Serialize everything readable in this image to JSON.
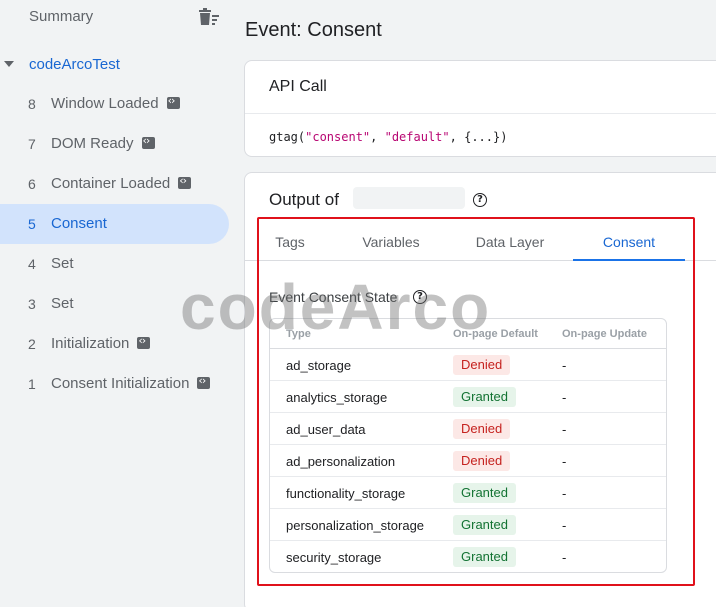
{
  "sidebar": {
    "summary_label": "Summary",
    "container_name": "codeArcoTest",
    "events": [
      {
        "num": "8",
        "label": "Window Loaded",
        "has_code": true,
        "active": false
      },
      {
        "num": "7",
        "label": "DOM Ready",
        "has_code": true,
        "active": false
      },
      {
        "num": "6",
        "label": "Container Loaded",
        "has_code": true,
        "active": false
      },
      {
        "num": "5",
        "label": "Consent",
        "has_code": false,
        "active": true
      },
      {
        "num": "4",
        "label": "Set",
        "has_code": false,
        "active": false
      },
      {
        "num": "3",
        "label": "Set",
        "has_code": false,
        "active": false
      },
      {
        "num": "2",
        "label": "Initialization",
        "has_code": true,
        "active": false
      },
      {
        "num": "1",
        "label": "Consent Initialization",
        "has_code": true,
        "active": false
      }
    ]
  },
  "main": {
    "title": "Event: Consent",
    "api_call": {
      "title": "API Call",
      "code_prefix": "gtag(",
      "arg1": "\"consent\"",
      "sep": ", ",
      "arg2": "\"default\"",
      "code_suffix": ", {...})"
    },
    "output": {
      "title": "Output of",
      "tabs": [
        "Tags",
        "Variables",
        "Data Layer",
        "Consent"
      ],
      "active_tab": "Consent",
      "section_title": "Event Consent State",
      "columns": [
        "Type",
        "On-page Default",
        "On-page Update"
      ],
      "rows": [
        {
          "type": "ad_storage",
          "default": "Denied",
          "update": "-"
        },
        {
          "type": "analytics_storage",
          "default": "Granted",
          "update": "-"
        },
        {
          "type": "ad_user_data",
          "default": "Denied",
          "update": "-"
        },
        {
          "type": "ad_personalization",
          "default": "Denied",
          "update": "-"
        },
        {
          "type": "functionality_storage",
          "default": "Granted",
          "update": "-"
        },
        {
          "type": "personalization_storage",
          "default": "Granted",
          "update": "-"
        },
        {
          "type": "security_storage",
          "default": "Granted",
          "update": "-"
        }
      ]
    }
  },
  "watermark": "codeArco",
  "colors": {
    "accent": "#1a73e8",
    "highlight_box": "#e0111b",
    "denied": "#c5221f",
    "granted": "#137333"
  }
}
